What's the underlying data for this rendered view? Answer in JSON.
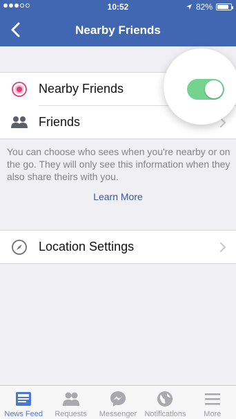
{
  "status": {
    "time": "10:52",
    "battery": "82%",
    "battery_level": 0.82
  },
  "nav": {
    "title": "Nearby Friends",
    "back_icon": "chevron-left-icon"
  },
  "settings": {
    "nearby_label": "Nearby Friends",
    "nearby_enabled": true,
    "friends_label": "Friends"
  },
  "info": {
    "text": "You can choose who sees when you're nearby or on the go. They will only see this information when they also share theirs with you.",
    "learn_more": "Learn More"
  },
  "location": {
    "label": "Location Settings"
  },
  "tabs": [
    {
      "label": "News Feed",
      "icon": "news-feed-icon",
      "active": true
    },
    {
      "label": "Requests",
      "icon": "friend-requests-icon",
      "active": false
    },
    {
      "label": "Messenger",
      "icon": "messenger-icon",
      "active": false
    },
    {
      "label": "Notifications",
      "icon": "globe-icon",
      "active": false
    },
    {
      "label": "More",
      "icon": "menu-icon",
      "active": false
    }
  ],
  "colors": {
    "brand": "#4267b2",
    "toggle_on": "#73d38f",
    "nearby_icon": "#e23c77",
    "link": "#3b5998",
    "tab_active": "#4a78d3"
  }
}
